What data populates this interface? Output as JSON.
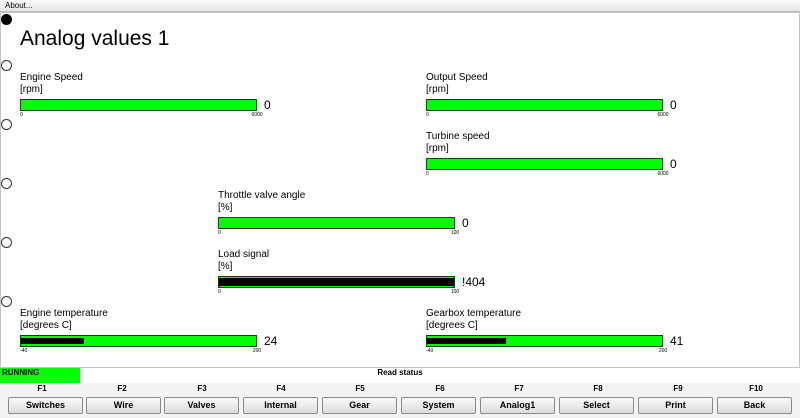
{
  "menu": {
    "about": "About..."
  },
  "page": {
    "title": "Analog values 1"
  },
  "radios": {
    "count": 6,
    "selected_index": 0
  },
  "gauges": {
    "engine_speed": {
      "label": "Engine Speed",
      "unit": "[rpm]",
      "value": "0",
      "min": "0",
      "max": "6000",
      "fill": 0
    },
    "output_speed": {
      "label": "Output Speed",
      "unit": "[rpm]",
      "value": "0",
      "min": "0",
      "max": "6000",
      "fill": 0
    },
    "turbine_speed": {
      "label": "Turbine speed",
      "unit": "[rpm]",
      "value": "0",
      "min": "0",
      "max": "6000",
      "fill": 0
    },
    "throttle": {
      "label": "Throttle valve angle",
      "unit": "[%]",
      "value": "0",
      "min": "0",
      "max": "100",
      "fill": 0
    },
    "load_signal": {
      "label": "Load signal",
      "unit": "[%]",
      "value": "!404",
      "min": "0",
      "max": "100",
      "fill": 1.0
    },
    "engine_temp": {
      "label": "Engine temperature",
      "unit": "[degrees C]",
      "value": "24",
      "min": "-40",
      "max": "200",
      "fill": 0.267
    },
    "gearbox_temp": {
      "label": "Gearbox temperature",
      "unit": "[degrees C]",
      "value": "41",
      "min": "-40",
      "max": "200",
      "fill": 0.338
    }
  },
  "status": {
    "running": "RUNNING",
    "read_status": "Read status"
  },
  "fkeys": [
    {
      "key": "F1",
      "label": "Switches"
    },
    {
      "key": "F2",
      "label": "Wire"
    },
    {
      "key": "F3",
      "label": "Valves"
    },
    {
      "key": "F4",
      "label": "Internal"
    },
    {
      "key": "F5",
      "label": "Gear"
    },
    {
      "key": "F6",
      "label": "System"
    },
    {
      "key": "F7",
      "label": "Analog1"
    },
    {
      "key": "F8",
      "label": "Select"
    },
    {
      "key": "F9",
      "label": "Print"
    },
    {
      "key": "F10",
      "label": "Back"
    }
  ],
  "colors": {
    "bar_green": "#00ff00",
    "bar_fill": "#000000",
    "running_bg": "#00ff00"
  }
}
